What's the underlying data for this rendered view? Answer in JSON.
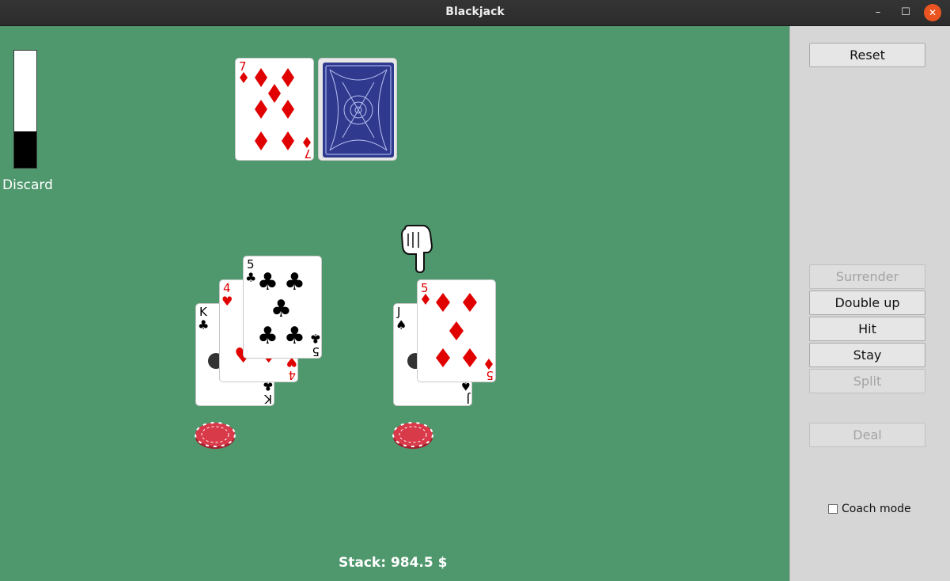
{
  "window": {
    "title": "Blackjack",
    "minimize_glyph": "–",
    "maximize_glyph": "☐",
    "close_glyph": "✕"
  },
  "discard": {
    "label": "Discard",
    "fill_fraction": 0.31
  },
  "dealer": {
    "cards": [
      {
        "rank": "7",
        "suit": "diamonds",
        "face_up": true
      },
      {
        "face_up": false
      }
    ]
  },
  "player": {
    "hands": [
      {
        "cards": [
          {
            "rank": "K",
            "suit": "clubs"
          },
          {
            "rank": "4",
            "suit": "hearts"
          },
          {
            "rank": "5",
            "suit": "clubs"
          }
        ],
        "bet_chip": "red-chip"
      },
      {
        "cards": [
          {
            "rank": "J",
            "suit": "spades"
          },
          {
            "rank": "5",
            "suit": "diamonds"
          }
        ],
        "bet_chip": "red-chip",
        "active": true
      }
    ]
  },
  "stack_label": "Stack: 984.5 $",
  "controls": {
    "reset": "Reset",
    "surrender": "Surrender",
    "double_up": "Double up",
    "hit": "Hit",
    "stay": "Stay",
    "split": "Split",
    "deal": "Deal",
    "coach_mode": "Coach mode",
    "coach_mode_checked": false
  },
  "colors": {
    "felt": "#4f976d",
    "red_suit": "#e00000",
    "black_suit": "#000000",
    "card_back": "#2f3a8f",
    "chip": "#d93a4a",
    "panel": "#d6d6d6"
  }
}
